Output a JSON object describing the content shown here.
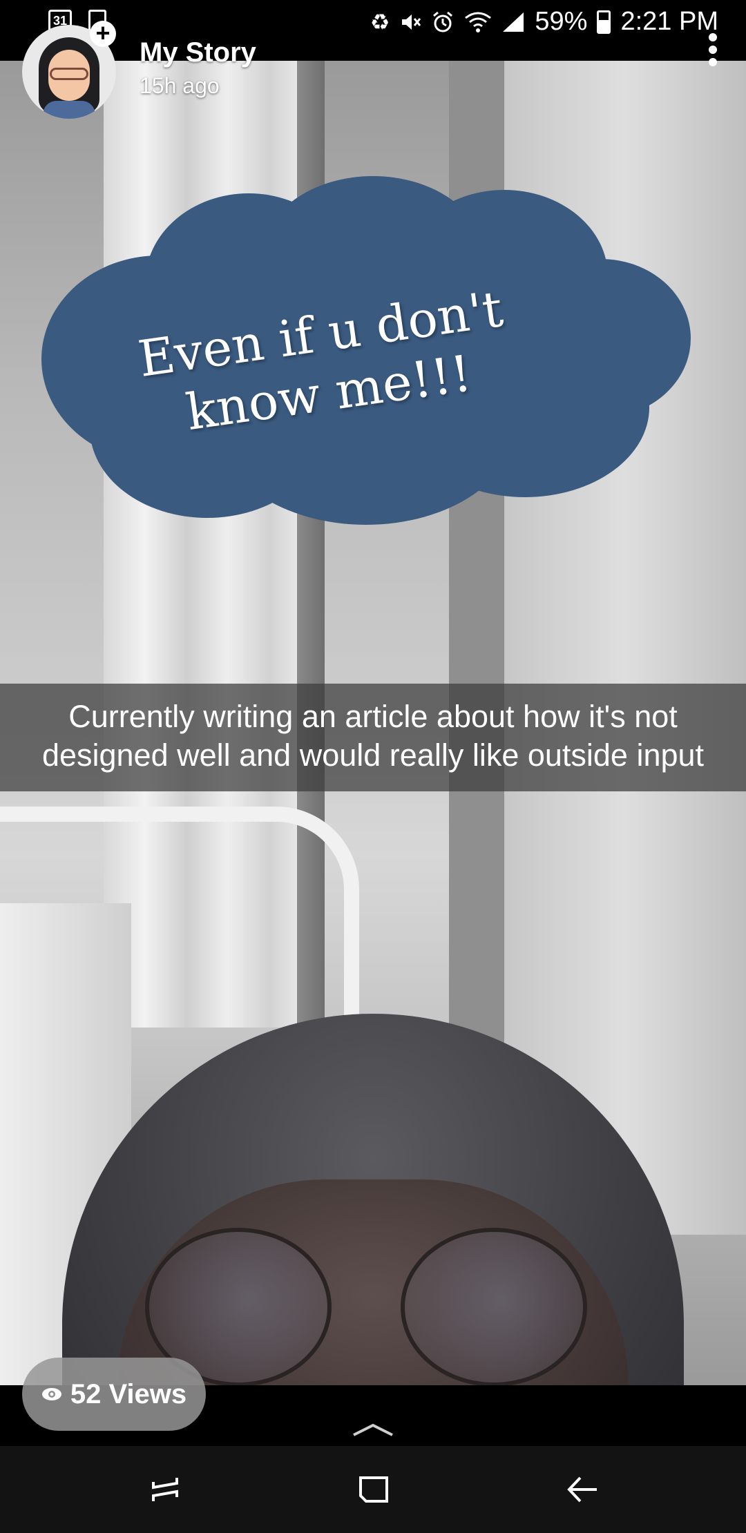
{
  "status_bar": {
    "calendar_day": "31",
    "battery": "59%",
    "time": "2:21 PM",
    "icons": [
      "calendar-icon",
      "screenshot-icon",
      "recycle-icon",
      "mute-icon",
      "alarm-icon",
      "wifi-icon",
      "signal-icon",
      "battery-icon"
    ]
  },
  "header": {
    "title": "My Story",
    "time_ago": "15h ago",
    "add_badge": "+",
    "more_icon": "more-vertical-icon",
    "avatar_icon": "bitmoji-avatar"
  },
  "sticker": {
    "line1": "Even if u don't",
    "line2": "know me!!!",
    "color": "#3a5a80"
  },
  "caption": {
    "line1": "Currently writing an article about how it's not",
    "line2": "designed well and would really like outside input"
  },
  "views": {
    "label": "52 Views",
    "icon": "eye-icon"
  },
  "bottom": {
    "swipe_up_icon": "chevron-up-icon",
    "nav": [
      "recent-apps-icon",
      "home-icon",
      "back-icon"
    ]
  }
}
